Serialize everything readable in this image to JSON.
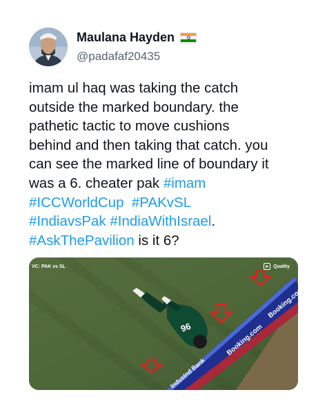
{
  "user": {
    "display_name": "Maulana Hayden",
    "handle": "@padafaf20435",
    "flag_icon": "india-flag-icon",
    "flag_colors": [
      "#ff9933",
      "#ffffff",
      "#138808"
    ]
  },
  "tweet": {
    "lines": [
      [
        {
          "text": "imam ul haq was taking the catch",
          "tag": false
        }
      ],
      [
        {
          "text": "outside the marked boundary. the",
          "tag": false
        }
      ],
      [
        {
          "text": "pathetic tactic to move cushions",
          "tag": false
        }
      ],
      [
        {
          "text": "behind and then taking that catch. you",
          "tag": false
        }
      ],
      [
        {
          "text": "can see the marked line of boundary it",
          "tag": false
        }
      ],
      [
        {
          "text": "was a 6. cheater pak ",
          "tag": false
        },
        {
          "text": "#imam",
          "tag": true
        }
      ],
      [
        {
          "text": "#ICCWorldCup",
          "tag": true
        },
        {
          "text": "  ",
          "tag": false
        },
        {
          "text": "#PAKvSL",
          "tag": true
        }
      ],
      [
        {
          "text": "#IndiavsPak",
          "tag": true
        },
        {
          "text": " ",
          "tag": false
        },
        {
          "text": "#IndiaWithIsrael",
          "tag": true
        },
        {
          "text": ".",
          "tag": false
        }
      ],
      [
        {
          "text": "#AskThePavilion",
          "tag": true
        },
        {
          "text": " is it 6?",
          "tag": false
        }
      ]
    ],
    "link_color": "#1d9bf0"
  },
  "media": {
    "video_label": "VC: PAK vs SL",
    "quality_label": "Quality",
    "play_icon": "play-icon",
    "boundary_sponsor": "IndusInd Bank",
    "boundary_sponsor_2": "Booking.com",
    "arrow_icon": "red-down-arrow-icon",
    "player_shirt_number": "96"
  }
}
